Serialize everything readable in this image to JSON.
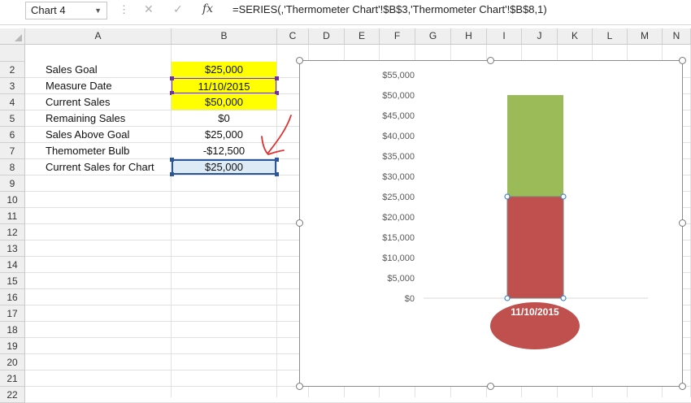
{
  "formula_bar": {
    "name_box": "Chart 4",
    "dots": "⋮",
    "cancel": "✕",
    "enter": "✓",
    "fx": "fx",
    "formula": "=SERIES(,'Thermometer Chart'!$B$3,'Thermometer Chart'!$B$8,1)"
  },
  "columns": [
    "A",
    "B",
    "C",
    "D",
    "E",
    "F",
    "G",
    "H",
    "I",
    "J",
    "K",
    "L",
    "M",
    "N"
  ],
  "rows": [
    "2",
    "3",
    "4",
    "5",
    "6",
    "7",
    "8",
    "9",
    "10",
    "11",
    "12",
    "13",
    "14",
    "15",
    "16",
    "17",
    "18",
    "19",
    "20",
    "21",
    "22"
  ],
  "cells": [
    {
      "label": "Sales Goal",
      "value": "$25,000",
      "style": "yellow"
    },
    {
      "label": "Measure Date",
      "value": "11/10/2015",
      "style": "yellow-purple"
    },
    {
      "label": "Current Sales",
      "value": "$50,000",
      "style": "yellow"
    },
    {
      "label": "Remaining Sales",
      "value": "$0",
      "style": ""
    },
    {
      "label": "Sales Above Goal",
      "value": "$25,000",
      "style": ""
    },
    {
      "label": "Themometer Bulb",
      "value": "-$12,500",
      "style": ""
    },
    {
      "label": "Current Sales for Chart",
      "value": "$25,000",
      "style": "blue"
    }
  ],
  "colors": {
    "goal_bar": "#c0504d",
    "above_bar": "#9bbb59",
    "bulb": "#c0504d",
    "selection_blue": "#2b579a",
    "selection_purple": "#7030a0",
    "annotation": "#e03030"
  },
  "chart_data": {
    "type": "bar",
    "stacked": true,
    "categories": [
      "11/10/2015"
    ],
    "series": [
      {
        "values": [
          25000
        ],
        "color": "#c0504d"
      },
      {
        "values": [
          25000
        ],
        "color": "#9bbb59"
      }
    ],
    "bulb_value": -12500,
    "y_ticks": [
      "$0",
      "$5,000",
      "$10,000",
      "$15,000",
      "$20,000",
      "$25,000",
      "$30,000",
      "$35,000",
      "$40,000",
      "$45,000",
      "$50,000",
      "$55,000"
    ],
    "ylim": [
      0,
      55000
    ],
    "title": "",
    "xlabel": "",
    "ylabel": "",
    "grid": false,
    "legend": "none"
  }
}
